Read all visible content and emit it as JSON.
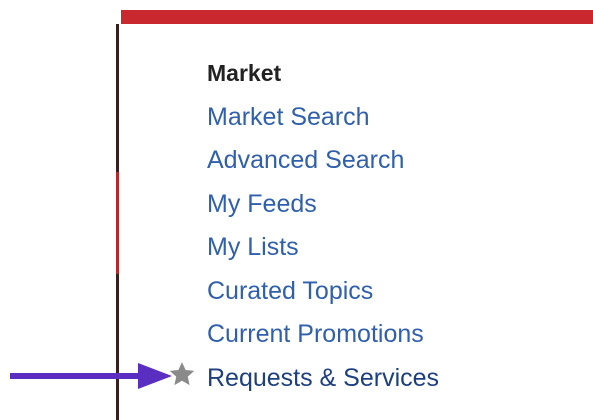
{
  "menu": {
    "heading": "Market",
    "items": [
      {
        "label": "Market Search"
      },
      {
        "label": "Advanced Search"
      },
      {
        "label": "My Feeds"
      },
      {
        "label": "My Lists"
      },
      {
        "label": "Curated Topics"
      },
      {
        "label": "Current Promotions"
      },
      {
        "label": "Requests & Services",
        "icon": "star-icon"
      }
    ]
  },
  "annotation": {
    "arrow_icon": "arrow-right-icon",
    "arrow_color": "#5b2ec2"
  },
  "colors": {
    "accent_bar": "#c8282e",
    "link": "#2f5fad",
    "heading": "#222222",
    "star": "#8a8a8a"
  }
}
